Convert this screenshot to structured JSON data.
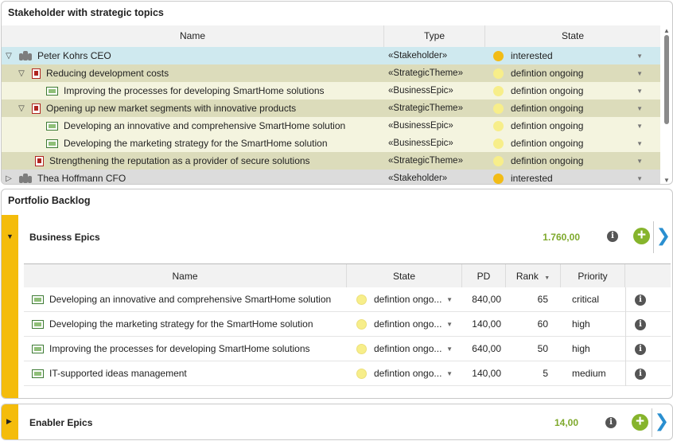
{
  "stakeholder_panel": {
    "title": "Stakeholder with strategic topics",
    "columns": {
      "name": "Name",
      "type": "Type",
      "state": "State"
    },
    "rows": [
      {
        "name": "Peter Kohrs CEO",
        "type": "«Stakeholder»",
        "state": "interested",
        "expander": "▽",
        "icon": "people-icon",
        "status_color": "#f2bc16"
      },
      {
        "name": "Reducing development costs",
        "type": "«StrategicTheme»",
        "state": "defintion ongoing",
        "expander": "▽",
        "icon": "strategic-theme-icon",
        "status_color": "#f7ee8a"
      },
      {
        "name": "Improving the processes for developing SmartHome solutions",
        "type": "«BusinessEpic»",
        "state": "defintion ongoing",
        "expander": "",
        "icon": "business-epic-icon",
        "status_color": "#f7ee8a"
      },
      {
        "name": "Opening up new market segments with innovative products",
        "type": "«StrategicTheme»",
        "state": "defintion ongoing",
        "expander": "▽",
        "icon": "strategic-theme-icon",
        "status_color": "#f7ee8a"
      },
      {
        "name": "Developing an innovative and comprehensive SmartHome solution",
        "type": "«BusinessEpic»",
        "state": "defintion ongoing",
        "expander": "",
        "icon": "business-epic-icon",
        "status_color": "#f7ee8a"
      },
      {
        "name": "Developing the marketing strategy for the SmartHome solution",
        "type": "«BusinessEpic»",
        "state": "defintion ongoing",
        "expander": "",
        "icon": "business-epic-icon",
        "status_color": "#f7ee8a"
      },
      {
        "name": "Strengthening the reputation as a provider of secure solutions",
        "type": "«StrategicTheme»",
        "state": "defintion ongoing",
        "expander": "",
        "icon": "strategic-theme-icon",
        "status_color": "#f7ee8a"
      },
      {
        "name": "Thea Hoffmann CFO",
        "type": "«Stakeholder»",
        "state": "interested",
        "expander": "▷",
        "icon": "people-icon",
        "status_color": "#f2bc16"
      }
    ]
  },
  "backlog_panel": {
    "title": "Portfolio Backlog",
    "business_epics": {
      "title": "Business Epics",
      "value": "1.760,00",
      "toggle": "▼",
      "columns": {
        "name": "Name",
        "state": "State",
        "pd": "PD",
        "rank": "Rank",
        "rank_sort": "▼",
        "priority": "Priority"
      },
      "rows": [
        {
          "name": "Developing an innovative and comprehensive SmartHome solution",
          "state": "defintion ongo...",
          "pd": "840,00",
          "rank": "65",
          "priority": "critical"
        },
        {
          "name": "Developing the marketing strategy for the SmartHome solution",
          "state": "defintion ongo...",
          "pd": "140,00",
          "rank": "60",
          "priority": "high"
        },
        {
          "name": "Improving the processes for developing SmartHome solutions",
          "state": "defintion ongo...",
          "pd": "640,00",
          "rank": "50",
          "priority": "high"
        },
        {
          "name": "IT-supported ideas management",
          "state": "defintion ongo...",
          "pd": "140,00",
          "rank": "5",
          "priority": "medium"
        }
      ]
    },
    "enabler_epics": {
      "title": "Enabler Epics",
      "value": "14,00",
      "toggle": "▶"
    }
  },
  "glyphs": {
    "info": "i",
    "plus": "+",
    "chevron_right": "❯",
    "dropdown": "▼"
  },
  "colors": {
    "accent_yellow": "#f4bc0b",
    "value_green": "#7ea92c",
    "add_green": "#86b42c",
    "chevron_blue": "#2a8fd0",
    "selected_row": "#cfe9ef",
    "theme_row": "#dcdcbb",
    "epic_row": "#f4f4df"
  }
}
